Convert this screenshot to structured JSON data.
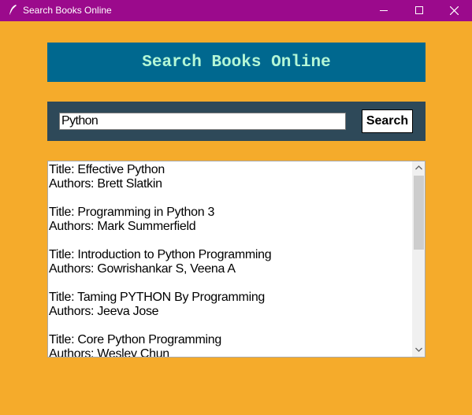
{
  "window": {
    "title": "Search Books Online",
    "icon": "feather-icon",
    "controls": [
      "minimize-icon",
      "maximize-icon",
      "close-icon"
    ]
  },
  "banner": {
    "title": "Search Books Online"
  },
  "search": {
    "value": "Python",
    "button_label": "Search"
  },
  "results": [
    {
      "title": "Title: Effective Python",
      "authors": "Authors: Brett Slatkin"
    },
    {
      "title": "Title: Programming in Python 3",
      "authors": "Authors: Mark Summerfield"
    },
    {
      "title": "Title: Introduction to Python Programming",
      "authors": "Authors: Gowrishankar S, Veena A"
    },
    {
      "title": "Title: Taming PYTHON By Programming",
      "authors": "Authors: Jeeva Jose"
    },
    {
      "title": "Title: Core Python Programming",
      "authors": "Authors: Wesley Chun"
    }
  ],
  "colors": {
    "background": "#f5ab2b",
    "titlebar": "#9b0a8c",
    "banner_bg": "#00688f",
    "banner_text": "#b4f7d6",
    "search_panel": "#2e4959"
  }
}
